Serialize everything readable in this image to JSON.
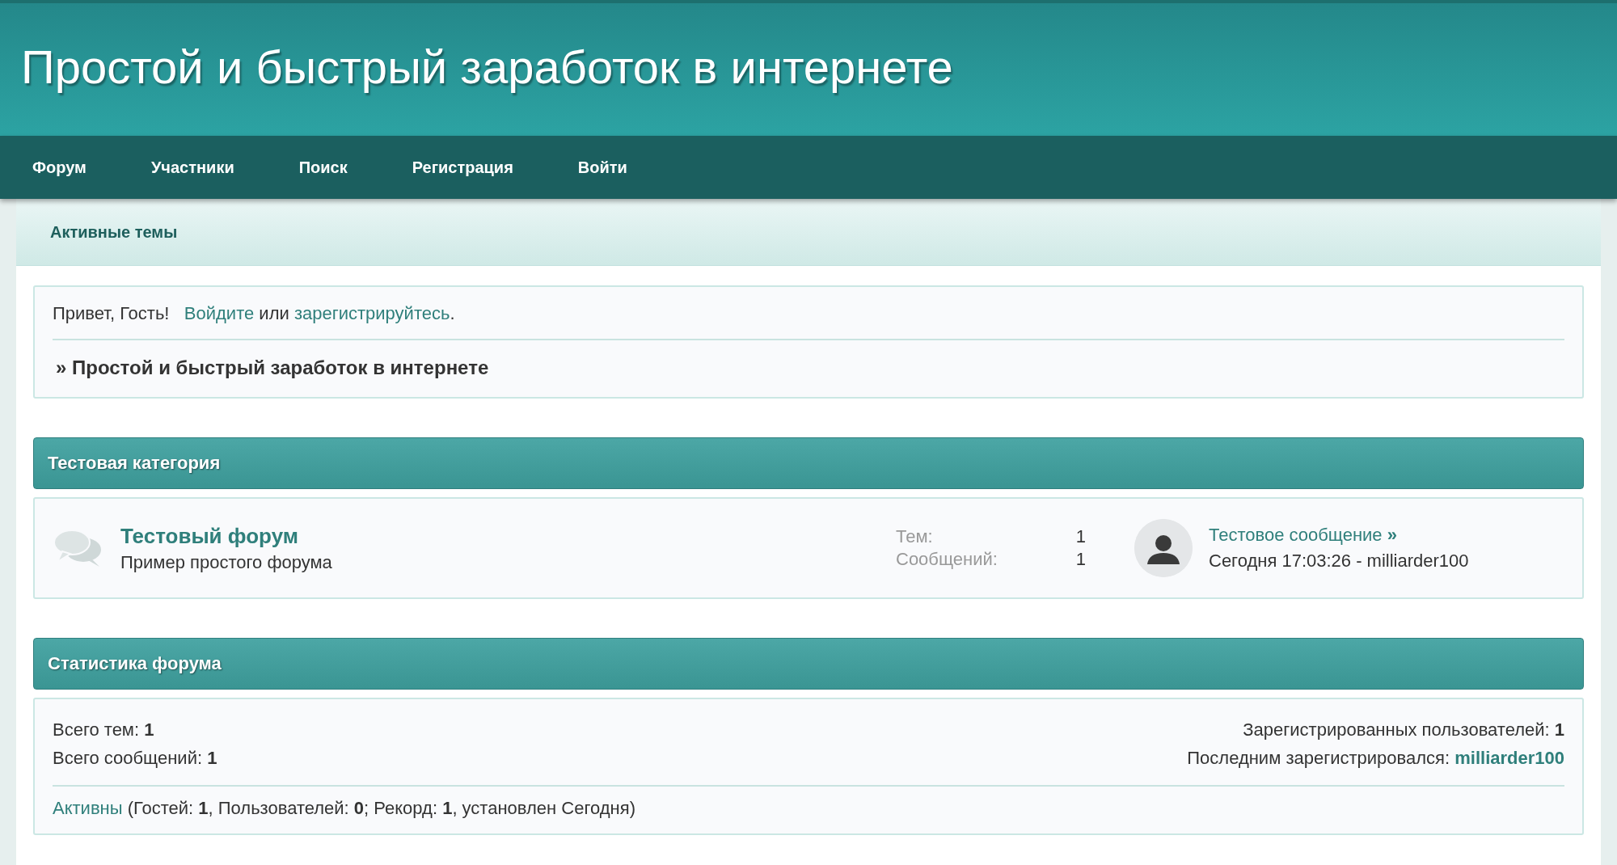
{
  "header": {
    "title": "Простой и быстрый заработок в интернете"
  },
  "nav": [
    {
      "label": "Форум"
    },
    {
      "label": "Участники"
    },
    {
      "label": "Поиск"
    },
    {
      "label": "Регистрация"
    },
    {
      "label": "Войти"
    }
  ],
  "subnav": {
    "label": "Активные темы"
  },
  "welcome": {
    "greeting": "Привет, Гость!",
    "login_link": "Войдите",
    "middle": "или",
    "register_link": "зарегистрируйтесь",
    "end": ".",
    "breadcrumb": "» Простой и быстрый заработок в интернете"
  },
  "categories": [
    {
      "title": "Тестовая категория",
      "forums": [
        {
          "name": "Тестовый форум",
          "description": "Пример простого форума",
          "stats": [
            {
              "label": "Тем:",
              "value": "1"
            },
            {
              "label": "Сообщений:",
              "value": "1"
            }
          ],
          "last_post": {
            "title": "Тестовое сообщение",
            "arrow": "»",
            "meta": "Сегодня 17:03:26 - milliarder100"
          }
        }
      ]
    }
  ],
  "statistics": {
    "title": "Статистика форума",
    "left": [
      "Всего тем: **1**",
      "Всего сообщений: **1**"
    ],
    "registered": "Зарегистрированных пользователей: **1**",
    "last_label": "Последним зарегистрировался:",
    "last_user": "milliarder100",
    "online_link": "Активны",
    "online_rest": "(Гостей: **1**, Пользователей: **0**; Рекорд: **1**, установлен Сегодня)"
  }
}
